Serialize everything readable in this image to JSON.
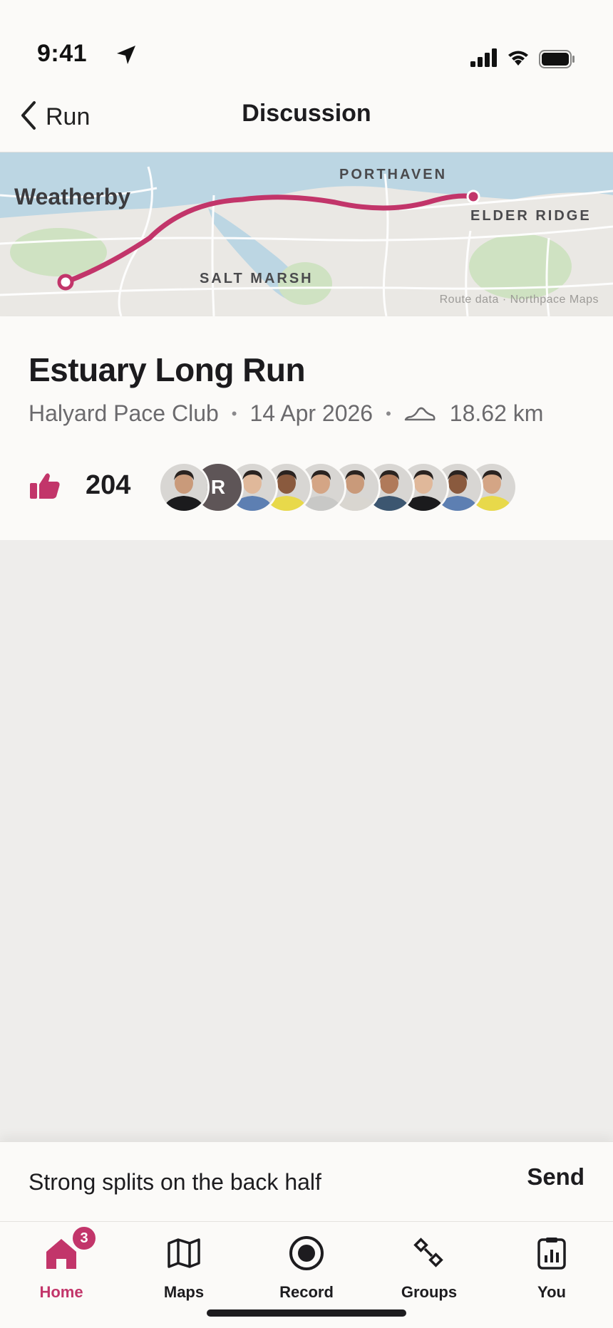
{
  "status_bar": {
    "time": "9:41"
  },
  "nav": {
    "back_label": "Run",
    "title": "Discussion"
  },
  "map": {
    "labels": {
      "city": "Weatherby",
      "north": "PORTHAVEN",
      "east": "ELDER RIDGE",
      "south": "SALT MARSH"
    },
    "attribution": "Route data · Northpace Maps",
    "route_color": "#c2356a"
  },
  "activity": {
    "title": "Estuary Long Run",
    "club": "Halyard Pace Club",
    "date": "14 Apr 2026",
    "distance": "18.62 km",
    "kudos_count": "204",
    "avatars": [
      {
        "kind": "photo",
        "tone": "#1b1b1d"
      },
      {
        "kind": "initial",
        "initial": "R",
        "bg": "#5e5557"
      },
      {
        "kind": "photo",
        "tone": "#5d7fb2"
      },
      {
        "kind": "photo",
        "tone": "#e8d94a"
      },
      {
        "kind": "photo",
        "tone": "#c8c8c6"
      },
      {
        "kind": "photo",
        "tone": "#d9d6d0"
      },
      {
        "kind": "photo",
        "tone": "#3c5670"
      },
      {
        "kind": "photo",
        "tone": "#1b1b1d"
      },
      {
        "kind": "photo",
        "tone": "#5d7fb2"
      },
      {
        "kind": "photo",
        "tone": "#e8d94a"
      }
    ]
  },
  "composer": {
    "value": "Strong splits on the back half",
    "send_label": "Send"
  },
  "tabs": [
    {
      "label": "Home",
      "icon": "home-icon",
      "badge": "3",
      "active": true
    },
    {
      "label": "Maps",
      "icon": "map-icon"
    },
    {
      "label": "Record",
      "icon": "record-icon"
    },
    {
      "label": "Groups",
      "icon": "groups-icon"
    },
    {
      "label": "You",
      "icon": "stats-icon"
    }
  ],
  "colors": {
    "accent": "#c2356a"
  }
}
